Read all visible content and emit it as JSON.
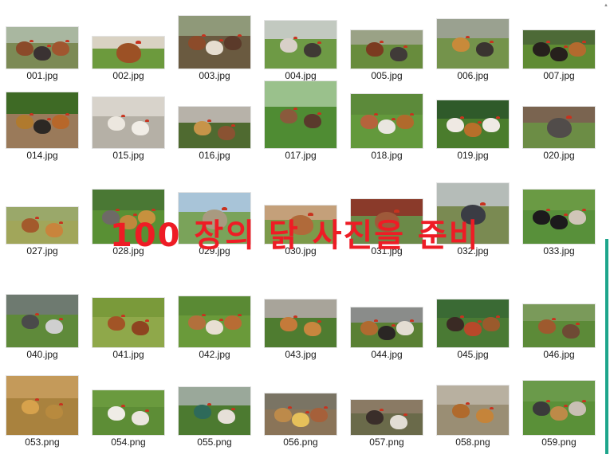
{
  "overlay": {
    "caption": "100 장의 닭 사진을 준비"
  },
  "files": [
    {
      "name": "001.jpg",
      "sky": "#a9b7a0",
      "ground": "#7c8a55",
      "hens": [
        "#8b4a2a",
        "#3a3232",
        "#a0562f"
      ]
    },
    {
      "name": "002.jpg",
      "sky": "#d9d2c3",
      "ground": "#6c9a3d",
      "hens": [
        "#9c5125"
      ]
    },
    {
      "name": "003.jpg",
      "sky": "#8f9979",
      "ground": "#6a5a40",
      "hens": [
        "#8c4b2a",
        "#e6ddd0",
        "#5b3a2a"
      ]
    },
    {
      "name": "004.jpg",
      "sky": "#c2c9c0",
      "ground": "#6e9a45",
      "hens": [
        "#d8d0c8",
        "#3f3a34"
      ]
    },
    {
      "name": "005.jpg",
      "sky": "#9aa286",
      "ground": "#688c3d",
      "hens": [
        "#7b3b20",
        "#403a38"
      ]
    },
    {
      "name": "006.jpg",
      "sky": "#9aa190",
      "ground": "#74934b",
      "hens": [
        "#c88a3a",
        "#3a3430"
      ]
    },
    {
      "name": "007.jpg",
      "sky": "#4d6a37",
      "ground": "#5f8b33",
      "hens": [
        "#26201c",
        "#26201c",
        "#b36a2e"
      ]
    },
    {
      "name": "014.jpg",
      "sky": "#3e6a25",
      "ground": "#9a7a5a",
      "hens": [
        "#b07a2e",
        "#2c2824",
        "#b7672a"
      ]
    },
    {
      "name": "015.jpg",
      "sky": "#d8d3cb",
      "ground": "#b5b0a6",
      "hens": [
        "#ece7df",
        "#f1ede6"
      ]
    },
    {
      "name": "016.jpg",
      "sky": "#b7b2a9",
      "ground": "#4f6a30",
      "hens": [
        "#c79449",
        "#8a5232"
      ]
    },
    {
      "name": "017.jpg",
      "sky": "#9ac18c",
      "ground": "#4f8c33",
      "hens": [
        "#8a5a3c",
        "#5a3a2c"
      ]
    },
    {
      "name": "018.jpg",
      "sky": "#5c8a3a",
      "ground": "#63993c",
      "hens": [
        "#b5633c",
        "#e9e6e0",
        "#b06a2c"
      ]
    },
    {
      "name": "019.jpg",
      "sky": "#2f5a2a",
      "ground": "#4a7c2c",
      "hens": [
        "#efe9e3",
        "#b86f2a",
        "#efeae4"
      ]
    },
    {
      "name": "020.jpg",
      "sky": "#7a6450",
      "ground": "#6c8d45",
      "hens": [
        "#514c4a"
      ]
    },
    {
      "name": "027.jpg",
      "sky": "#9aa86a",
      "ground": "#a1a65a",
      "hens": [
        "#a35a2c",
        "#c9843c"
      ]
    },
    {
      "name": "028.jpg",
      "sky": "#4a7834",
      "ground": "#599034",
      "hens": [
        "#6e6a66",
        "#c0873c",
        "#c7913e"
      ]
    },
    {
      "name": "029.jpg",
      "sky": "#a8c4d8",
      "ground": "#7aa35a",
      "hens": [
        "#a89a80"
      ]
    },
    {
      "name": "030.jpg",
      "sky": "#c4a07a",
      "ground": "#7c9a4a",
      "hens": [
        "#b06a3a"
      ]
    },
    {
      "name": "031.jpg",
      "sky": "#8a3a2a",
      "ground": "#6b8a48",
      "hens": [
        "#9e5a3a"
      ]
    },
    {
      "name": "032.jpg",
      "sky": "#b5bcb8",
      "ground": "#7a8a52",
      "hens": [
        "#3a3c44"
      ]
    },
    {
      "name": "033.jpg",
      "sky": "#6a9a44",
      "ground": "#58903a",
      "hens": [
        "#1c1a1c",
        "#1c1a1c",
        "#d0c5b8"
      ]
    },
    {
      "name": "040.jpg",
      "sky": "#6e7a70",
      "ground": "#5f8a3a",
      "hens": [
        "#4a4a4a",
        "#cfcfcf"
      ]
    },
    {
      "name": "041.jpg",
      "sky": "#7a9a3a",
      "ground": "#8fa84a",
      "hens": [
        "#a25426",
        "#8e4420"
      ]
    },
    {
      "name": "042.jpg",
      "sky": "#5a8a34",
      "ground": "#6a9a3a",
      "hens": [
        "#b2703c",
        "#e8dfd2",
        "#b86c34"
      ]
    },
    {
      "name": "043.jpg",
      "sky": "#a8a49a",
      "ground": "#4f7c30",
      "hens": [
        "#c47a3a",
        "#c8863e"
      ]
    },
    {
      "name": "044.jpg",
      "sky": "#8a8c8a",
      "ground": "#5a8034",
      "hens": [
        "#b06a30",
        "#2a2624",
        "#e3ddd2"
      ]
    },
    {
      "name": "045.jpg",
      "sky": "#3a6a34",
      "ground": "#4a7a34",
      "hens": [
        "#3a2a24",
        "#b8482a",
        "#9a5a2c"
      ]
    },
    {
      "name": "046.jpg",
      "sky": "#7a9a5a",
      "ground": "#5c8a38",
      "hens": [
        "#9e5a2e",
        "#6e4a34"
      ]
    },
    {
      "name": "053.png",
      "sky": "#c49a5a",
      "ground": "#a9823e",
      "hens": [
        "#d7a24c",
        "#b88a3e"
      ]
    },
    {
      "name": "054.png",
      "sky": "#6a9a3e",
      "ground": "#5d8d36",
      "hens": [
        "#efece6",
        "#ebe6de"
      ]
    },
    {
      "name": "055.png",
      "sky": "#9aa89a",
      "ground": "#4c7a30",
      "hens": [
        "#2e6a5a",
        "#e6e0d8"
      ]
    },
    {
      "name": "056.png",
      "sky": "#7a7464",
      "ground": "#8a7458",
      "hens": [
        "#bd8a4a",
        "#e6c05a",
        "#a6603a"
      ]
    },
    {
      "name": "057.png",
      "sky": "#8a7a64",
      "ground": "#6a6a4a",
      "hens": [
        "#3a2e2a",
        "#e2ddd4"
      ]
    },
    {
      "name": "058.png",
      "sky": "#b8b0a0",
      "ground": "#9a8e74",
      "hens": [
        "#b06a2c",
        "#c5843a"
      ]
    },
    {
      "name": "059.png",
      "sky": "#6a9a4a",
      "ground": "#5a9038",
      "hens": [
        "#3a3a3a",
        "#bd8a48",
        "#c9bfb4"
      ]
    }
  ]
}
